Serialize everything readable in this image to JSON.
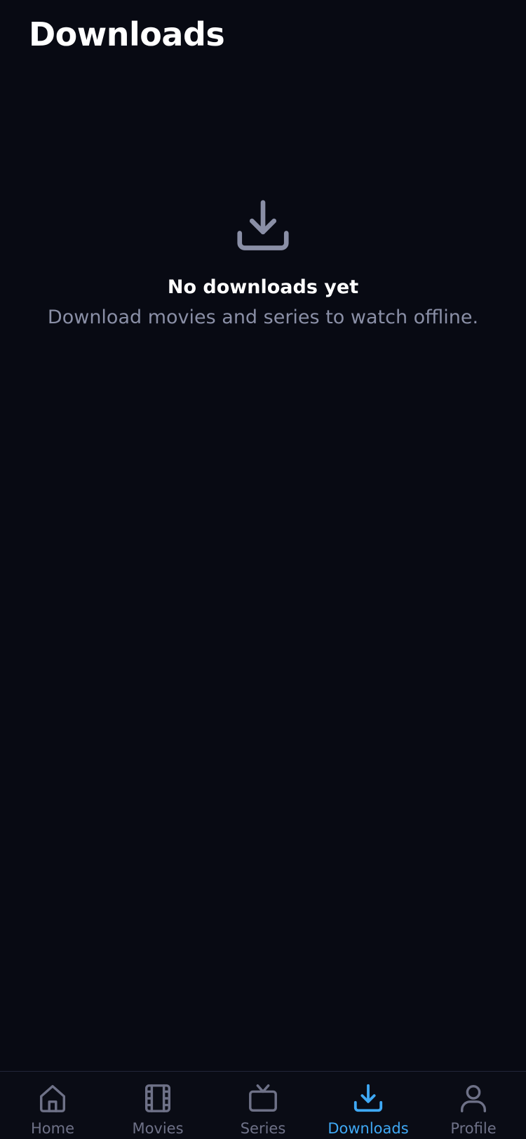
{
  "header": {
    "title": "Downloads"
  },
  "empty_state": {
    "icon": "download-icon",
    "title": "No downloads yet",
    "subtitle": "Download movies and series to watch offline."
  },
  "tabbar": {
    "active": "Downloads",
    "items": [
      {
        "label": "Home",
        "icon": "home-icon"
      },
      {
        "label": "Movies",
        "icon": "film-icon"
      },
      {
        "label": "Series",
        "icon": "tv-icon"
      },
      {
        "label": "Downloads",
        "icon": "download-icon"
      },
      {
        "label": "Profile",
        "icon": "profile-icon"
      }
    ]
  },
  "colors": {
    "background": "#080a13",
    "accent": "#3fa9f5",
    "muted": "#8a8fa6",
    "inactive_tab": "#6e7187"
  }
}
